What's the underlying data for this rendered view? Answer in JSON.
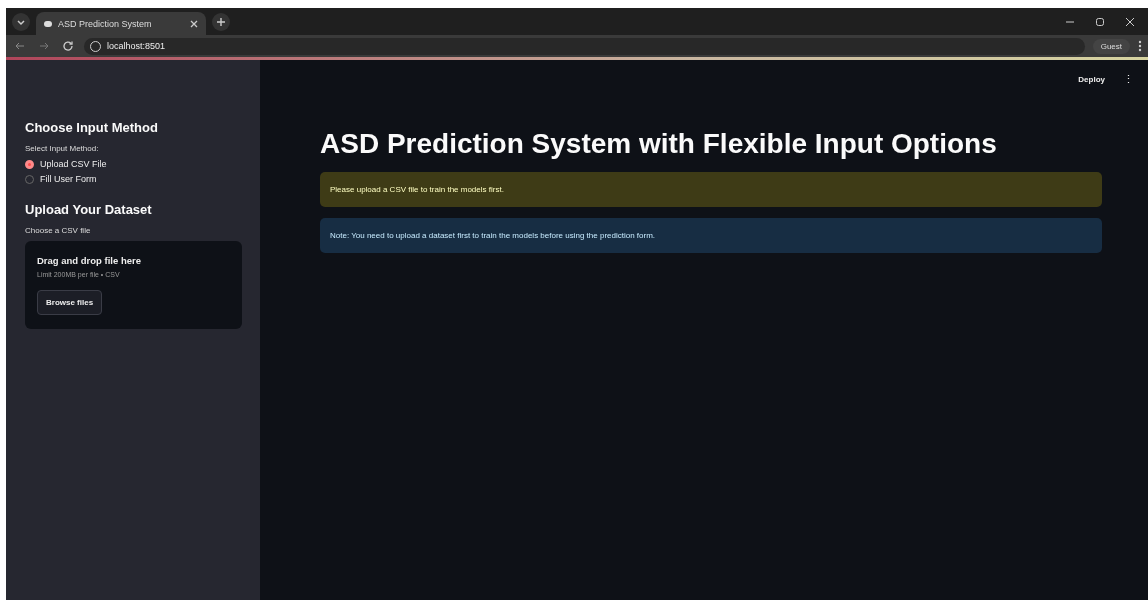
{
  "browser": {
    "tab_title": "ASD Prediction System",
    "url": "localhost:8501",
    "profile": "Guest"
  },
  "header": {
    "deploy": "Deploy",
    "menu": "⋮"
  },
  "sidebar": {
    "input_section": {
      "title": "Choose Input Method",
      "label": "Select Input Method:",
      "options": [
        {
          "label": "Upload CSV File",
          "selected": true
        },
        {
          "label": "Fill User Form",
          "selected": false
        }
      ]
    },
    "upload_section": {
      "title": "Upload Your Dataset",
      "label": "Choose a CSV file",
      "dropzone": {
        "title": "Drag and drop file here",
        "hint": "Limit 200MB per file • CSV",
        "button": "Browse files"
      }
    }
  },
  "main": {
    "title": "ASD Prediction System with Flexible Input Options",
    "alerts": [
      {
        "kind": "warning",
        "text": "Please upload a CSV file to train the models first."
      },
      {
        "kind": "info",
        "text": "Note: You need to upload a dataset first to train the models before using the prediction form."
      }
    ]
  }
}
